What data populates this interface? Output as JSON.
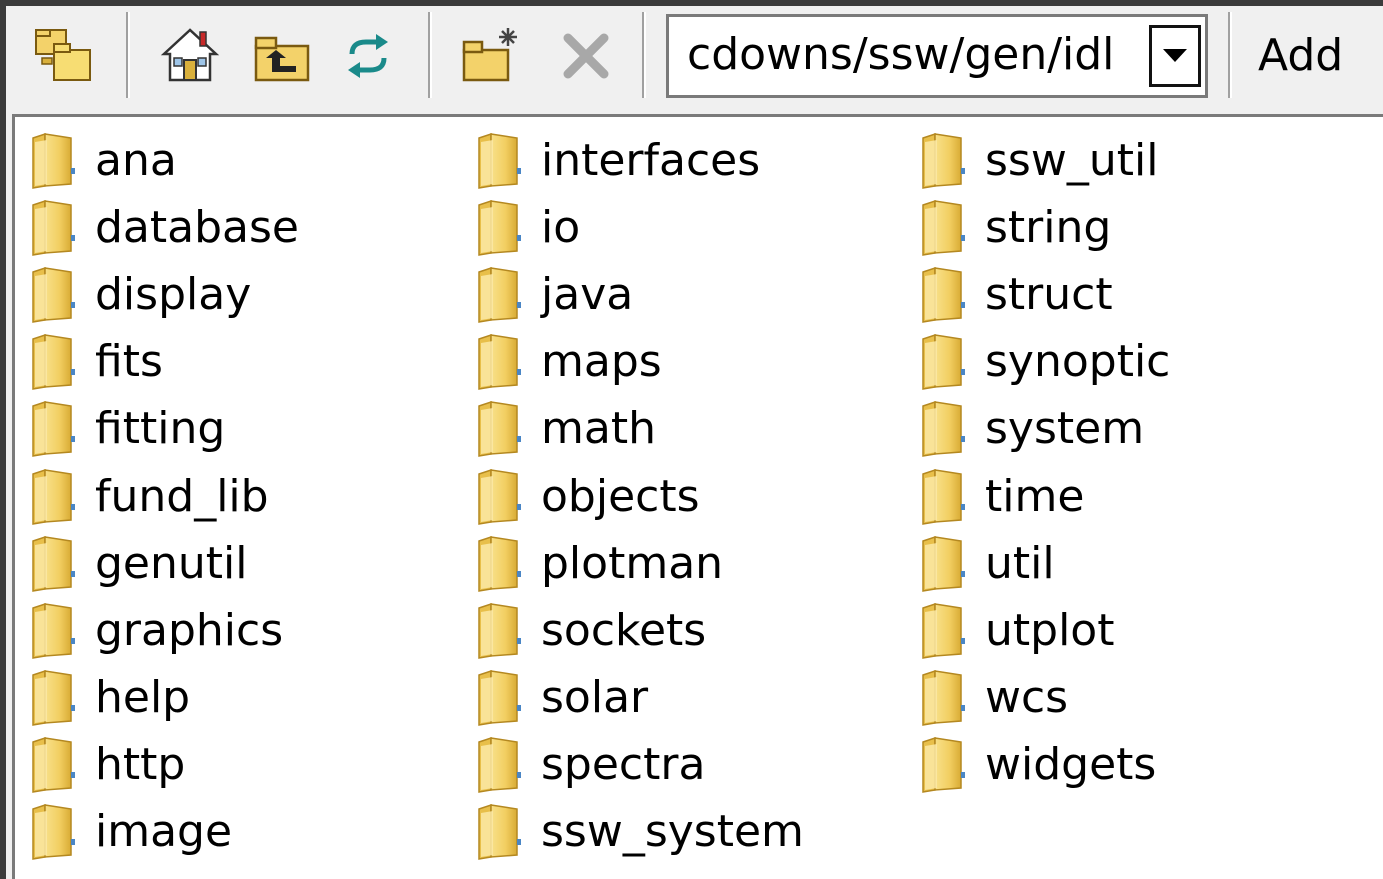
{
  "toolbar": {
    "path": "cdowns/ssw/gen/idl",
    "add_label": "Add",
    "icons": [
      "folders-icon",
      "home-icon",
      "up-folder-icon",
      "refresh-icon",
      "new-folder-icon",
      "delete-icon",
      "dropdown-arrow-icon"
    ]
  },
  "list": {
    "columns": [
      [
        "ana",
        "database",
        "display",
        "fits",
        "fitting",
        "fund_lib",
        "genutil",
        "graphics",
        "help",
        "http",
        "image"
      ],
      [
        "interfaces",
        "io",
        "java",
        "maps",
        "math",
        "objects",
        "plotman",
        "sockets",
        "solar",
        "spectra",
        "ssw_system"
      ],
      [
        "ssw_util",
        "string",
        "struct",
        "synoptic",
        "system",
        "time",
        "util",
        "utplot",
        "wcs",
        "widgets"
      ]
    ]
  },
  "colors": {
    "folder_light": "#fbe9a6",
    "folder_mid": "#f0cc5a",
    "folder_dark": "#d7a62b",
    "window_bg": "#f0f0f0",
    "frame": "#3b3b3b"
  }
}
